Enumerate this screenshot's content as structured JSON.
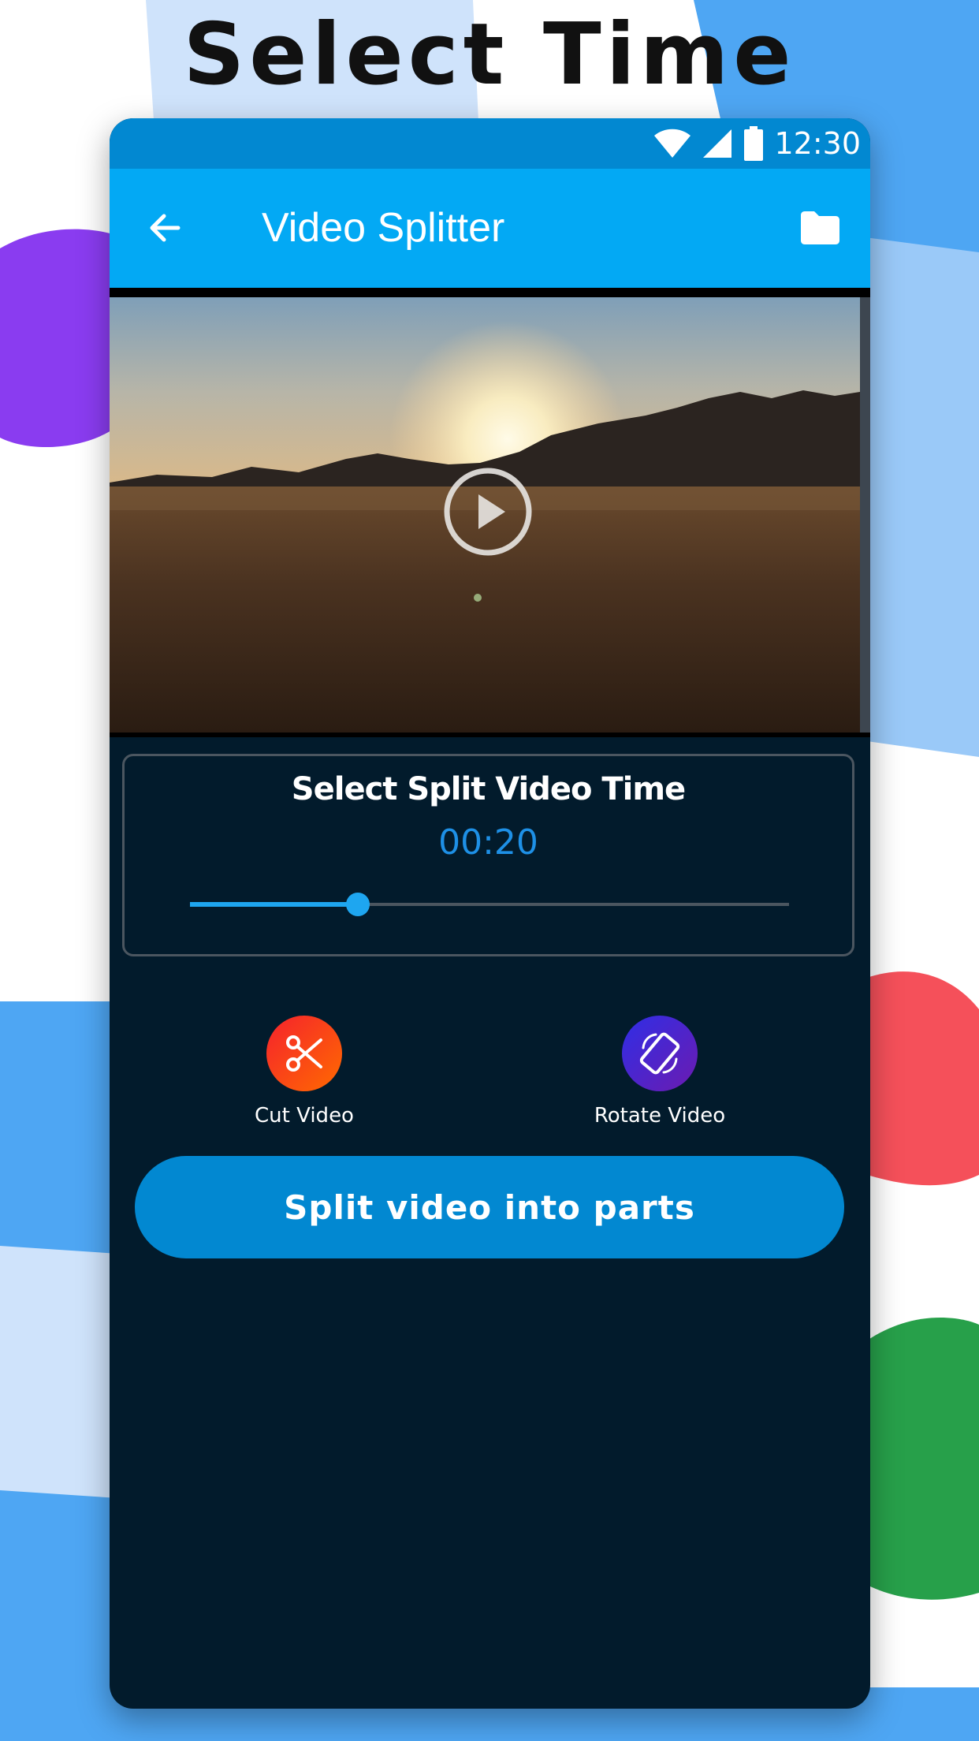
{
  "promo": {
    "title": "Select Time"
  },
  "status_bar": {
    "time": "12:30",
    "icons": [
      "wifi-icon",
      "signal-icon",
      "battery-icon"
    ]
  },
  "app_bar": {
    "title": "Video Splitter",
    "back_icon": "arrow-left-icon",
    "folder_icon": "folder-icon"
  },
  "video": {
    "play_icon": "play-circle-icon"
  },
  "split_card": {
    "title": "Select Split Video Time",
    "time_value": "00:20",
    "slider_value_fraction": 0.28
  },
  "actions": [
    {
      "label": "Cut Video",
      "icon": "scissors-icon"
    },
    {
      "label": "Rotate Video",
      "icon": "rotate-icon"
    }
  ],
  "primary_button": {
    "label": "Split video into parts"
  },
  "colors": {
    "app_bar": "#03a9f4",
    "status_bar": "#0288d1",
    "screen_bg": "#021b2c",
    "accent": "#1ea6f0",
    "time_text": "#1e90e6",
    "primary_button": "#0288d1"
  }
}
